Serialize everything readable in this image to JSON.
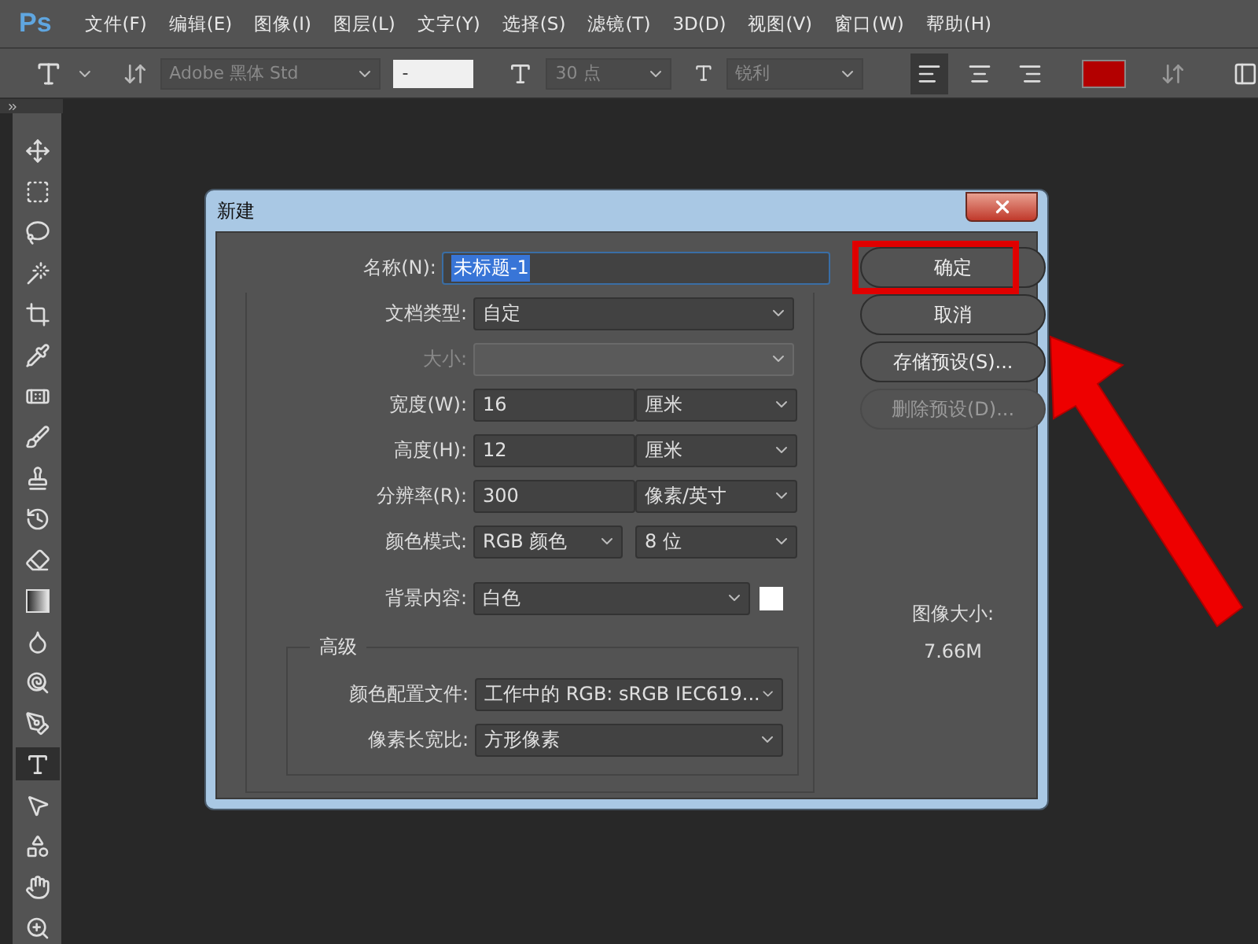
{
  "app_logo": "Ps",
  "menu": [
    "文件(F)",
    "编辑(E)",
    "图像(I)",
    "图层(L)",
    "文字(Y)",
    "选择(S)",
    "滤镜(T)",
    "3D(D)",
    "视图(V)",
    "窗口(W)",
    "帮助(H)"
  ],
  "options_bar": {
    "font_family": "Adobe 黑体 Std",
    "font_style": "-",
    "font_size": "30 点",
    "antialias": "锐利",
    "align": [
      {
        "kind": "left",
        "selected": true
      },
      {
        "kind": "center",
        "selected": false
      },
      {
        "kind": "right",
        "selected": false
      }
    ]
  },
  "tools": [
    {
      "kind": "move",
      "selected": false
    },
    {
      "kind": "marquee",
      "selected": false
    },
    {
      "kind": "lasso",
      "selected": false
    },
    {
      "kind": "wand",
      "selected": false
    },
    {
      "kind": "crop",
      "selected": false
    },
    {
      "kind": "pipette",
      "selected": false
    },
    {
      "kind": "bandage",
      "selected": false
    },
    {
      "kind": "brush",
      "selected": false
    },
    {
      "kind": "stamp",
      "selected": false
    },
    {
      "kind": "history",
      "selected": false
    },
    {
      "kind": "eraser",
      "selected": false
    },
    {
      "kind": "gradient",
      "selected": false
    },
    {
      "kind": "droplet",
      "selected": false
    },
    {
      "kind": "dodge",
      "selected": false
    },
    {
      "kind": "pen",
      "selected": false
    },
    {
      "kind": "type",
      "selected": true
    },
    {
      "kind": "pointer",
      "selected": false
    },
    {
      "kind": "shape",
      "selected": false
    },
    {
      "kind": "hand",
      "selected": false
    },
    {
      "kind": "zoom",
      "selected": false
    }
  ],
  "dialog": {
    "title": "新建",
    "name_field": {
      "label": "名称(N):",
      "value": "未标题-1",
      "text_selected": true
    },
    "rows": [
      {
        "kind": "select",
        "label": "文档类型:",
        "value": "自定",
        "disabled": false
      },
      {
        "kind": "select",
        "label": "大小:",
        "disabled": true
      },
      {
        "kind": "input_unit",
        "label": "宽度(W):",
        "value": "16",
        "unit": "厘米"
      },
      {
        "kind": "input_unit",
        "label": "高度(H):",
        "value": "12",
        "unit": "厘米"
      },
      {
        "kind": "input_unit",
        "label": "分辨率(R):",
        "value": "300",
        "unit": "像素/英寸"
      },
      {
        "kind": "select_pair",
        "label": "颜色模式:",
        "value": "RGB 颜色",
        "unit": "8 位"
      },
      {
        "kind": "select_swatch",
        "label": "背景内容:",
        "value": "白色"
      }
    ],
    "advanced": {
      "title": "高级",
      "rows": [
        {
          "label": "颜色配置文件:",
          "value": "工作中的 RGB: sRGB IEC619..."
        },
        {
          "label": "像素长宽比:",
          "value": "方形像素"
        }
      ]
    },
    "buttons": [
      {
        "label": "确定",
        "disabled": false,
        "highlighted": true
      },
      {
        "label": "取消",
        "disabled": false,
        "highlighted": false
      },
      {
        "label": "存储预设(S)...",
        "disabled": false,
        "highlighted": false
      },
      {
        "label": "删除预设(D)...",
        "disabled": true,
        "highlighted": false
      }
    ],
    "image_size": {
      "label": "图像大小:",
      "value": "7.66M"
    }
  }
}
